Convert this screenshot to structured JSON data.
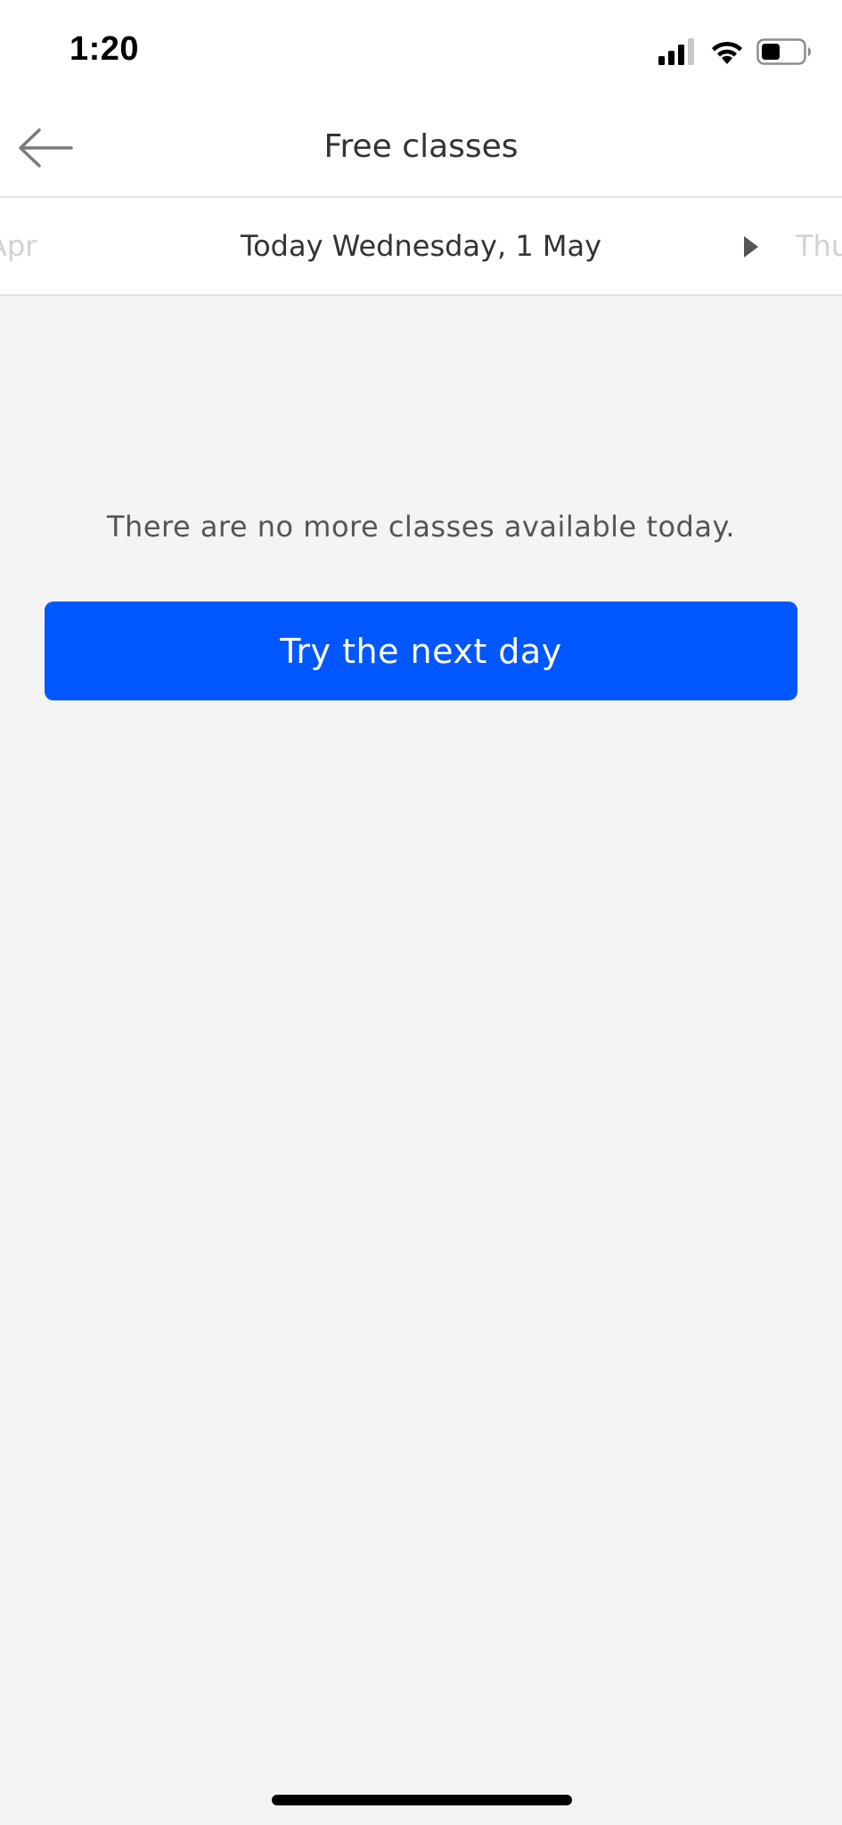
{
  "status_bar": {
    "time": "1:20"
  },
  "header": {
    "title": "Free classes"
  },
  "date_nav": {
    "prev_label": "Apr",
    "current_label": "Today Wednesday, 1 May",
    "next_label": "Thu"
  },
  "main": {
    "empty_message": "There are no more classes available today.",
    "next_day_button_label": "Try the next day"
  },
  "colors": {
    "accent": "#0057ff",
    "background": "#f4f4f4",
    "surface": "#ffffff"
  }
}
